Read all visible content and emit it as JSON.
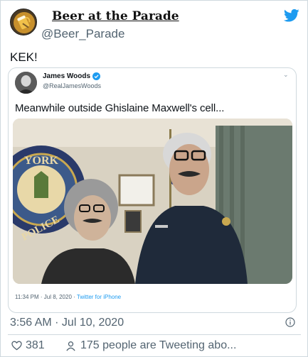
{
  "author": {
    "display_name": "Beer at the Parade",
    "handle": "@Beer_Parade",
    "avatar": "beer-mug-avatar"
  },
  "tweet": {
    "text": "KEK!",
    "timestamp": "3:56 AM · Jul 10, 2020",
    "likes": "381",
    "tweeting": "175 people are Tweeting abo..."
  },
  "quoted": {
    "name": "James Woods",
    "handle": "@RealJamesWoods",
    "text": "Meanwhile outside Ghislaine Maxwell's cell...",
    "meta_time": "11:34 PM · Jul 8, 2020 · ",
    "meta_source": "Twitter for iPhone",
    "photo_sign_text": "YORK",
    "photo_sign_text2": "POLICE"
  },
  "colors": {
    "twitter_blue": "#1d9bf0",
    "secondary_text": "#536471",
    "border": "#cfd9de"
  },
  "icons": [
    "twitter-bird-icon",
    "verified-badge-icon",
    "chevron-down-icon",
    "info-icon",
    "heart-icon",
    "person-icon"
  ]
}
